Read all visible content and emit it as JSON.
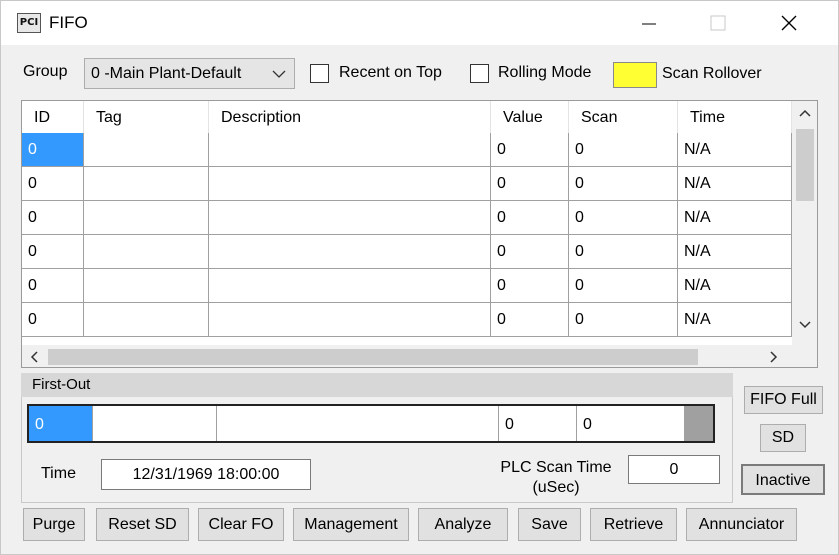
{
  "window": {
    "title": "FIFO",
    "icon_text": "PCI",
    "controls": [
      "minimize-icon",
      "maximize-icon",
      "close-icon"
    ]
  },
  "toolbar": {
    "group_label": "Group",
    "group_value": "0 -Main Plant-Default",
    "recent_on_top_label": "Recent on Top",
    "recent_on_top_checked": false,
    "rolling_mode_label": "Rolling Mode",
    "rolling_mode_checked": false,
    "scan_rollover_label": "Scan Rollover",
    "scan_rollover_color": "#ffff33"
  },
  "grid": {
    "columns": [
      "ID",
      "Tag",
      "Description",
      "Value",
      "Scan",
      "Time"
    ],
    "rows": [
      [
        "0",
        "",
        "",
        "0",
        "0",
        "N/A"
      ],
      [
        "0",
        "",
        "",
        "0",
        "0",
        "N/A"
      ],
      [
        "0",
        "",
        "",
        "0",
        "0",
        "N/A"
      ],
      [
        "0",
        "",
        "",
        "0",
        "0",
        "N/A"
      ],
      [
        "0",
        "",
        "",
        "0",
        "0",
        "N/A"
      ],
      [
        "0",
        "",
        "",
        "0",
        "0",
        "N/A"
      ]
    ],
    "selection_color": "#3399ff"
  },
  "first_out": {
    "title": "First-Out",
    "row": [
      "0",
      "",
      "",
      "0",
      "0"
    ],
    "time_label": "Time",
    "time_value": "12/31/1969 18:00:00",
    "plc_scan_label_line1": "PLC Scan Time",
    "plc_scan_label_line2": "(uSec)",
    "plc_scan_value": "0"
  },
  "status": {
    "fifo_full_label": "FIFO Full",
    "sd_label": "SD",
    "inactive_label": "Inactive"
  },
  "buttons": {
    "purge": "Purge",
    "reset_sd": "Reset SD",
    "clear_fo": "Clear FO",
    "management": "Management",
    "analyze": "Analyze",
    "save": "Save",
    "retrieve": "Retrieve",
    "annunciator": "Annunciator"
  }
}
